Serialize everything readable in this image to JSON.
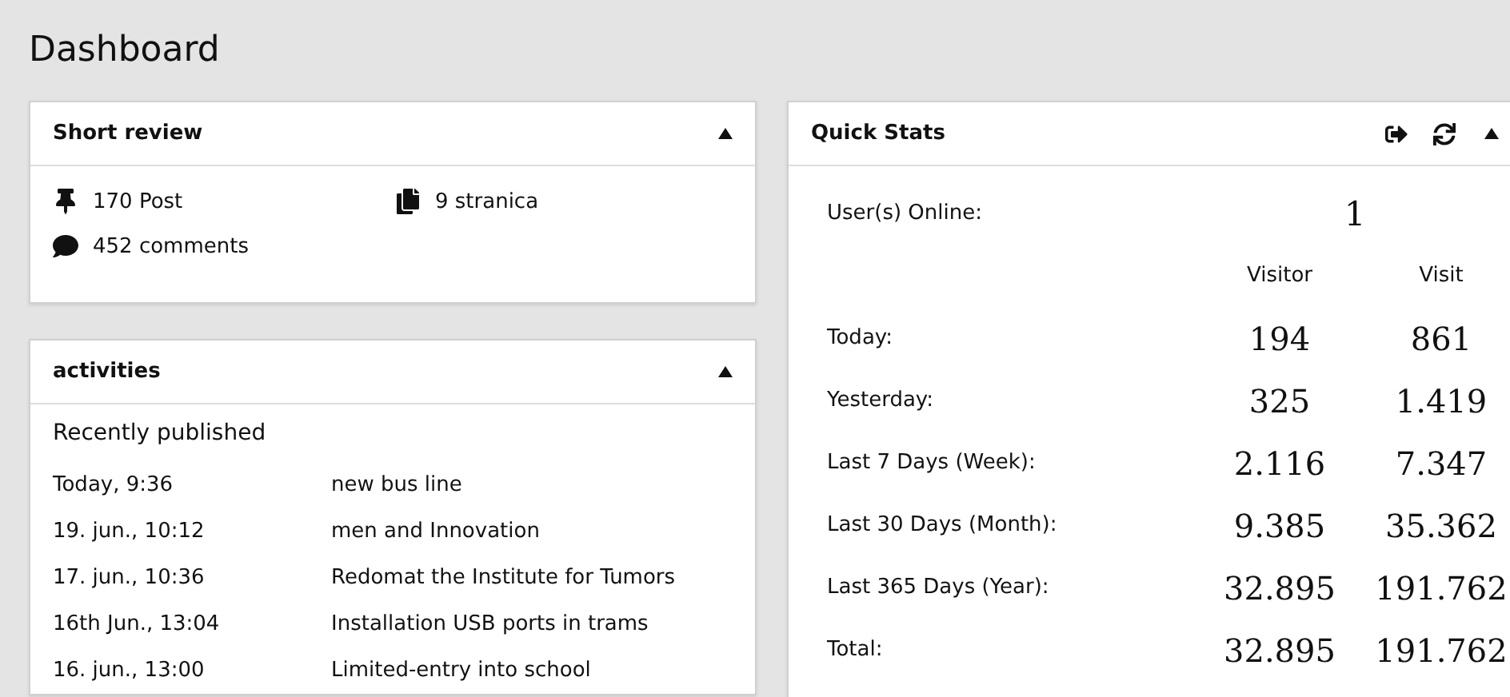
{
  "page": {
    "title": "Dashboard"
  },
  "short_review": {
    "title": "Short review",
    "expanded": true,
    "items": [
      {
        "kind": "posts",
        "label": "170 Post"
      },
      {
        "kind": "pages",
        "label": "9 stranica"
      },
      {
        "kind": "comments",
        "label": "452 comments"
      }
    ]
  },
  "activities": {
    "title": "activities",
    "expanded": true,
    "subtitle": "Recently published",
    "rows": [
      {
        "date": "Today, 9:36",
        "title": "new bus line"
      },
      {
        "date": "19. jun., 10:12",
        "title": "men and Innovation"
      },
      {
        "date": "17. jun., 10:36",
        "title": "Redomat the Institute for Tumors"
      },
      {
        "date": "16th Jun., 13:04",
        "title": "Installation USB ports in trams"
      },
      {
        "date": "16. jun., 13:00",
        "title": "Limited-entry into school"
      }
    ]
  },
  "quick_stats": {
    "title": "Quick Stats",
    "expanded": true,
    "online_label": "User(s) Online:",
    "online_value": "1",
    "columns": [
      "Visitor",
      "Visit"
    ],
    "rows": [
      {
        "label": "Today:",
        "visitor": "194",
        "visit": "861"
      },
      {
        "label": "Yesterday:",
        "visitor": "325",
        "visit": "1.419"
      },
      {
        "label": "Last 7 Days (Week):",
        "visitor": "2.116",
        "visit": "7.347"
      },
      {
        "label": "Last 30 Days (Month):",
        "visitor": "9.385",
        "visit": "35.362"
      },
      {
        "label": "Last 365 Days (Year):",
        "visitor": "32.895",
        "visit": "191.762"
      },
      {
        "label": "Total:",
        "visitor": "32.895",
        "visit": "191.762"
      }
    ]
  }
}
